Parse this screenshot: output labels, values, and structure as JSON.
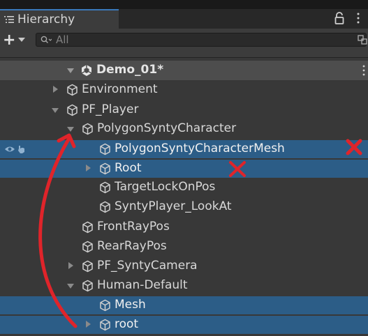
{
  "window": {
    "tab_title": "Hierarchy",
    "tab_icon": "hierarchy-list-icon",
    "lock_icon": "lock-icon",
    "menu_icon": "kebab-menu-icon"
  },
  "toolbar": {
    "add_label": "+",
    "add_dropdown_icon": "chevron-down-icon",
    "search_placeholder": "All",
    "search_icon": "search-icon",
    "filter_icon": "scene-filter-icon"
  },
  "scene": {
    "name": "Demo_01*",
    "icon": "unity-scene-icon",
    "expanded": true
  },
  "tree": [
    {
      "label": "Environment",
      "expander": "collapsed",
      "selected": false
    },
    {
      "label": "PF_Player",
      "expander": "expanded",
      "selected": false
    },
    {
      "label": "PolygonSyntyCharacter",
      "expander": "expanded",
      "selected": false
    },
    {
      "label": "PolygonSyntyCharacterMesh",
      "expander": "none",
      "selected": true,
      "visibility_icons": [
        "eye-icon",
        "pick-hand-icon"
      ]
    },
    {
      "label": "Root",
      "expander": "collapsed",
      "selected": true
    },
    {
      "label": "TargetLockOnPos",
      "expander": "none",
      "selected": false
    },
    {
      "label": "SyntyPlayer_LookAt",
      "expander": "none",
      "selected": false
    },
    {
      "label": "FrontRayPos",
      "expander": "none",
      "selected": false
    },
    {
      "label": "RearRayPos",
      "expander": "none",
      "selected": false
    },
    {
      "label": "PF_SyntyCamera",
      "expander": "collapsed",
      "selected": false
    },
    {
      "label": "Human-Default",
      "expander": "expanded",
      "selected": false
    },
    {
      "label": "Mesh",
      "expander": "none",
      "selected": true
    },
    {
      "label": "root",
      "expander": "collapsed",
      "selected": true
    }
  ],
  "annotations": {
    "marks": [
      "red-x-mark",
      "red-x-mark",
      "red-curved-arrow"
    ],
    "color": "#e0242a"
  },
  "colors": {
    "panel_bg": "#383838",
    "selection": "#2c5d87",
    "scene_row": "#4d4d4d",
    "tab_accent": "#3a79bb",
    "annotation_red": "#e0242a"
  }
}
